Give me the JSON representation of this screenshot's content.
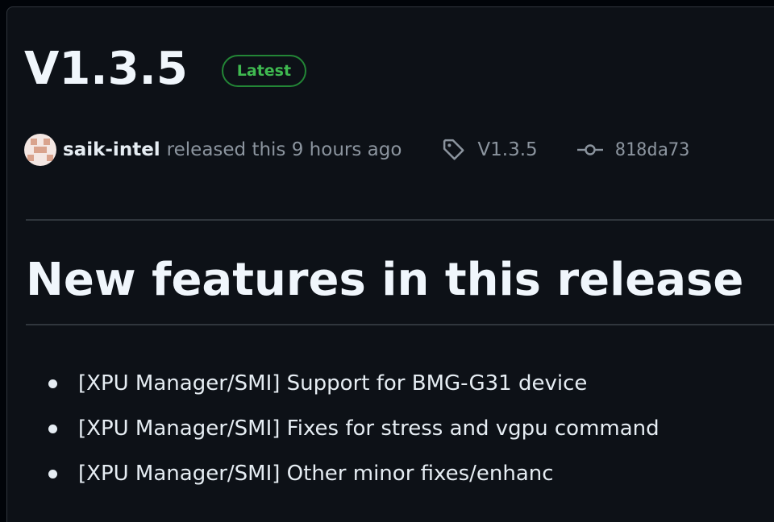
{
  "release": {
    "title": "V1.3.5",
    "badge": "Latest",
    "author": "saik-intel",
    "released_text": "released this 9 hours ago",
    "tag": "V1.3.5",
    "tag_icon": "tag-icon",
    "commit": "818da73",
    "commit_icon": "git-commit-icon"
  },
  "notes": {
    "heading": "New features in this release",
    "items": [
      "[XPU Manager/SMI] Support for BMG-G31 device",
      "[XPU Manager/SMI] Fixes for stress and vgpu command",
      "[XPU Manager/SMI] Other minor fixes/enhanc"
    ]
  },
  "colors": {
    "background": "#0d1117",
    "badge": "#3fb950",
    "badge_border": "#238636",
    "muted": "#8b949e",
    "text": "#e6edf3"
  }
}
